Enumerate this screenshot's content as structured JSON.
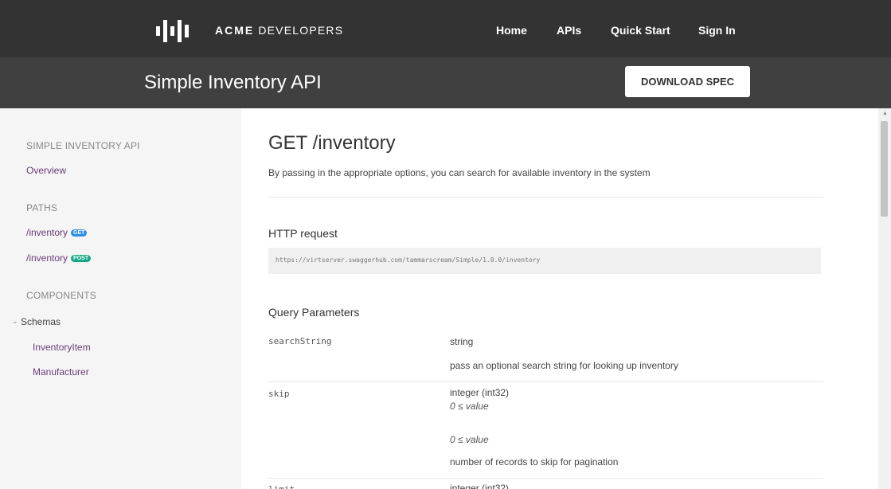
{
  "header": {
    "logo_bold": "ACME",
    "logo_rest": " DEVELOPERS",
    "nav": [
      "Home",
      "APIs",
      "Quick Start",
      "Sign In"
    ]
  },
  "title_bar": {
    "title": "Simple Inventory API",
    "download_label": "DOWNLOAD SPEC"
  },
  "sidebar": {
    "section_api": "SIMPLE INVENTORY API",
    "overview": "Overview",
    "section_paths": "PATHS",
    "paths": [
      {
        "label": "/inventory",
        "method": "GET"
      },
      {
        "label": "/inventory",
        "method": "POST"
      }
    ],
    "section_components": "COMPONENTS",
    "schemas_label": "Schemas",
    "schemas": [
      "InventoryItem",
      "Manufacturer"
    ]
  },
  "main": {
    "endpoint_title": "GET /inventory",
    "description": "By passing in the appropriate options, you can search for available inventory in the system",
    "http_request_heading": "HTTP request",
    "url": "https://virtserver.swaggerhub.com/tammarscream/Simple/1.0.0/inventory",
    "query_params_heading": "Query Parameters",
    "params": [
      {
        "name": "searchString",
        "type": "string",
        "note": "pass an optional search string for looking up inventory"
      },
      {
        "name": "skip",
        "type": "integer (int32)",
        "constraint1": "0 ≤ value",
        "constraint2": "0 ≤ value",
        "note": "number of records to skip for pagination"
      },
      {
        "name": "limit",
        "type": "integer (int32)"
      }
    ]
  },
  "colors": {
    "topbar": "#333333",
    "titlebar": "#404040",
    "sidebar": "#f5f5f5",
    "link": "#6c3a7a",
    "get_badge": "#2f8ee0",
    "post_badge": "#17a68a"
  }
}
